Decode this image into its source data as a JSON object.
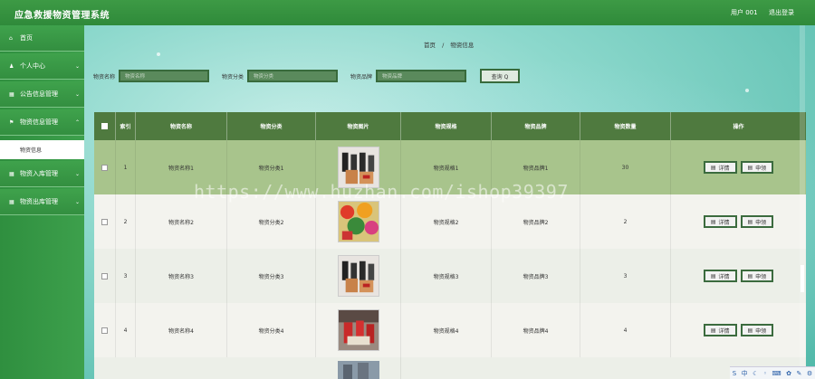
{
  "header": {
    "title": "应急救援物资管理系统",
    "user": "用户 001",
    "logout": "退出登录"
  },
  "sidebar": {
    "items": [
      {
        "label": "首页",
        "icon": "home-icon",
        "glyph": "⌂",
        "expand": false
      },
      {
        "label": "个人中心",
        "icon": "user-icon",
        "glyph": "♟",
        "expand": true
      },
      {
        "label": "公告信息管理",
        "icon": "grid-icon",
        "glyph": "▦",
        "expand": true
      },
      {
        "label": "物资信息管理",
        "icon": "flag-icon",
        "glyph": "⚑",
        "expand": true
      },
      {
        "label": "物资入库管理",
        "icon": "grid-icon",
        "glyph": "▦",
        "expand": true
      },
      {
        "label": "物资出库管理",
        "icon": "grid-icon",
        "glyph": "▦",
        "expand": true
      }
    ],
    "sub_item": "物资信息"
  },
  "breadcrumb": {
    "home": "首页",
    "sep": "/",
    "current": "物资信息"
  },
  "search": {
    "f1_label": "物资名称",
    "f1_placeholder": "物资名称",
    "f2_label": "物资分类",
    "f2_placeholder": "物资分类",
    "f3_label": "物资品牌",
    "f3_placeholder": "物资品牌",
    "button": "查询 Q"
  },
  "table": {
    "headers": [
      "索引",
      "物资名称",
      "物资分类",
      "物资图片",
      "物资规格",
      "物资品牌",
      "物资数量",
      "操作"
    ],
    "rows": [
      {
        "index": "1",
        "name": "物资名称1",
        "category": "物资分类1",
        "spec": "物资规格1",
        "brand": "物资品牌1",
        "qty": "30"
      },
      {
        "index": "2",
        "name": "物资名称2",
        "category": "物资分类2",
        "spec": "物资规格2",
        "brand": "物资品牌2",
        "qty": "2"
      },
      {
        "index": "3",
        "name": "物资名称3",
        "category": "物资分类3",
        "spec": "物资规格3",
        "brand": "物资品牌3",
        "qty": "3"
      },
      {
        "index": "4",
        "name": "物资名称4",
        "category": "物资分类4",
        "spec": "物资规格4",
        "brand": "物资品牌4",
        "qty": "4"
      }
    ],
    "detail_button": "详情",
    "apply_button": "申领"
  },
  "watermark": "https://www.huzhan.com/ishop39397",
  "taskbar": [
    "S",
    "中",
    "☾",
    "◦",
    "⌨",
    "✿",
    "✎",
    "⚙"
  ],
  "colors": {
    "topbar": "#348f3e",
    "header_row": "#4f7a3f",
    "selected_row": "#a8c48c",
    "row_even": "#f3f3ee",
    "row_odd": "#ecefe8"
  }
}
